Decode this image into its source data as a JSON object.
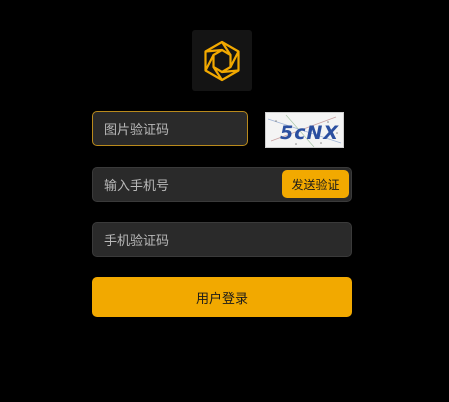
{
  "logo": {
    "icon": "hexagon-logo-icon",
    "color": "#f2a900"
  },
  "image_captcha": {
    "placeholder": "图片验证码",
    "captcha_text": "5cNX"
  },
  "phone": {
    "placeholder": "输入手机号",
    "send_code_label": "发送验证"
  },
  "sms_code": {
    "placeholder": "手机验证码"
  },
  "login": {
    "label": "用户登录"
  },
  "colors": {
    "accent": "#f2a900",
    "background": "#000000",
    "field": "#2a2a2a"
  }
}
